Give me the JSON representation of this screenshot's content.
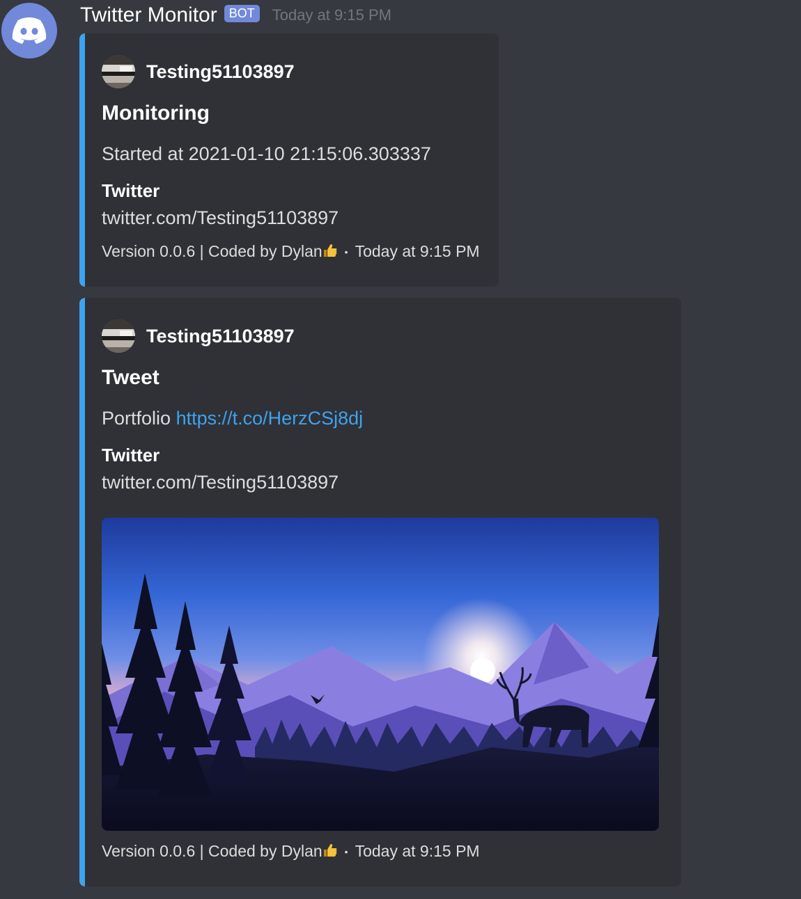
{
  "message": {
    "username": "Twitter Monitor",
    "bot_tag": "BOT",
    "timestamp": "Today at 9:15 PM"
  },
  "colors": {
    "background": "#36393f",
    "embed_background": "#2f3136",
    "embed_accent": "#3ea3ee",
    "bot_tag": "#7289da",
    "link": "#3ea3ee"
  },
  "embeds": [
    {
      "author": "Testing51103897",
      "title": "Monitoring",
      "description": "Started at 2021-01-10 21:15:06.303337",
      "field_name": "Twitter",
      "field_value": "twitter.com/Testing51103897",
      "footer_text": "Version 0.0.6 | Coded by Dylan",
      "footer_emoji": "thumbs-up-icon",
      "footer_separator": "•",
      "footer_timestamp": "Today at 9:15 PM"
    },
    {
      "author": "Testing51103897",
      "title": "Tweet",
      "description_text": "Portfolio",
      "description_link": "https://t.co/HerzCSj8dj",
      "field_name": "Twitter",
      "field_value": "twitter.com/Testing51103897",
      "image": "mountain-landscape-with-deer-image",
      "footer_text": "Version 0.0.6 | Coded by Dylan",
      "footer_emoji": "thumbs-up-icon",
      "footer_separator": "•",
      "footer_timestamp": "Today at 9:15 PM"
    }
  ]
}
